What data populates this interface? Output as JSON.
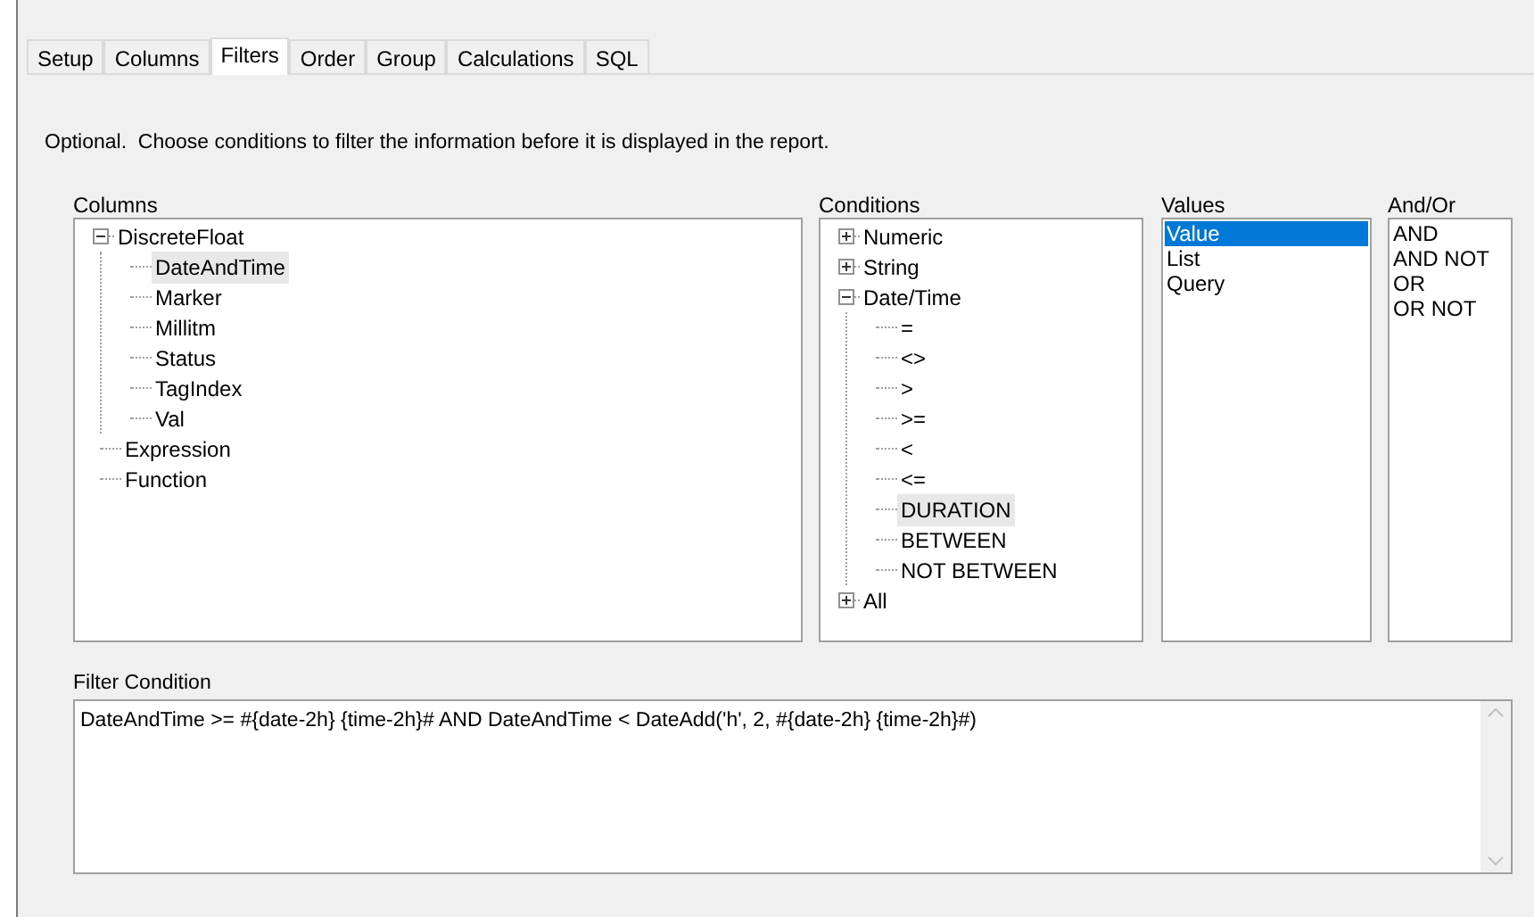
{
  "tabs": [
    {
      "label": "Setup",
      "selected": false
    },
    {
      "label": "Columns",
      "selected": false
    },
    {
      "label": "Filters",
      "selected": true
    },
    {
      "label": "Order",
      "selected": false
    },
    {
      "label": "Group",
      "selected": false
    },
    {
      "label": "Calculations",
      "selected": false
    },
    {
      "label": "SQL",
      "selected": false
    }
  ],
  "instructions": "Optional.  Choose conditions to filter the information before it is displayed in the report.",
  "columns": {
    "label": "Columns",
    "tree": [
      {
        "label": "DiscreteFloat",
        "selected": false,
        "expanded": true,
        "children": [
          {
            "label": "DateAndTime",
            "selected": true
          },
          {
            "label": "Marker",
            "selected": false
          },
          {
            "label": "Millitm",
            "selected": false
          },
          {
            "label": "Status",
            "selected": false
          },
          {
            "label": "TagIndex",
            "selected": false
          },
          {
            "label": "Val",
            "selected": false
          }
        ]
      },
      {
        "label": "Expression",
        "selected": false
      },
      {
        "label": "Function",
        "selected": false
      }
    ]
  },
  "conditions": {
    "label": "Conditions",
    "tree": [
      {
        "label": "Numeric",
        "selected": false,
        "expanded": false
      },
      {
        "label": "String",
        "selected": false,
        "expanded": false
      },
      {
        "label": "Date/Time",
        "selected": false,
        "expanded": true,
        "children": [
          {
            "label": "=",
            "selected": false
          },
          {
            "label": "<>",
            "selected": false
          },
          {
            "label": ">",
            "selected": false
          },
          {
            "label": ">=",
            "selected": false
          },
          {
            "label": "<",
            "selected": false
          },
          {
            "label": "<=",
            "selected": false
          },
          {
            "label": "DURATION",
            "selected": true
          },
          {
            "label": "BETWEEN",
            "selected": false
          },
          {
            "label": "NOT BETWEEN",
            "selected": false
          }
        ]
      },
      {
        "label": "All",
        "selected": false,
        "expanded": false
      }
    ]
  },
  "values": {
    "label": "Values",
    "items": [
      {
        "label": "Value",
        "selected": true
      },
      {
        "label": "List",
        "selected": false
      },
      {
        "label": "Query",
        "selected": false
      }
    ]
  },
  "and_or": {
    "label": "And/Or",
    "items": [
      {
        "label": "AND",
        "selected": false
      },
      {
        "label": "AND NOT",
        "selected": false
      },
      {
        "label": "OR",
        "selected": false
      },
      {
        "label": "OR NOT",
        "selected": false
      }
    ]
  },
  "filter_condition": {
    "label": "Filter Condition",
    "value": "DateAndTime >= #{date-2h} {time-2h}# AND DateAndTime < DateAdd('h', 2, #{date-2h} {time-2h}#)"
  }
}
